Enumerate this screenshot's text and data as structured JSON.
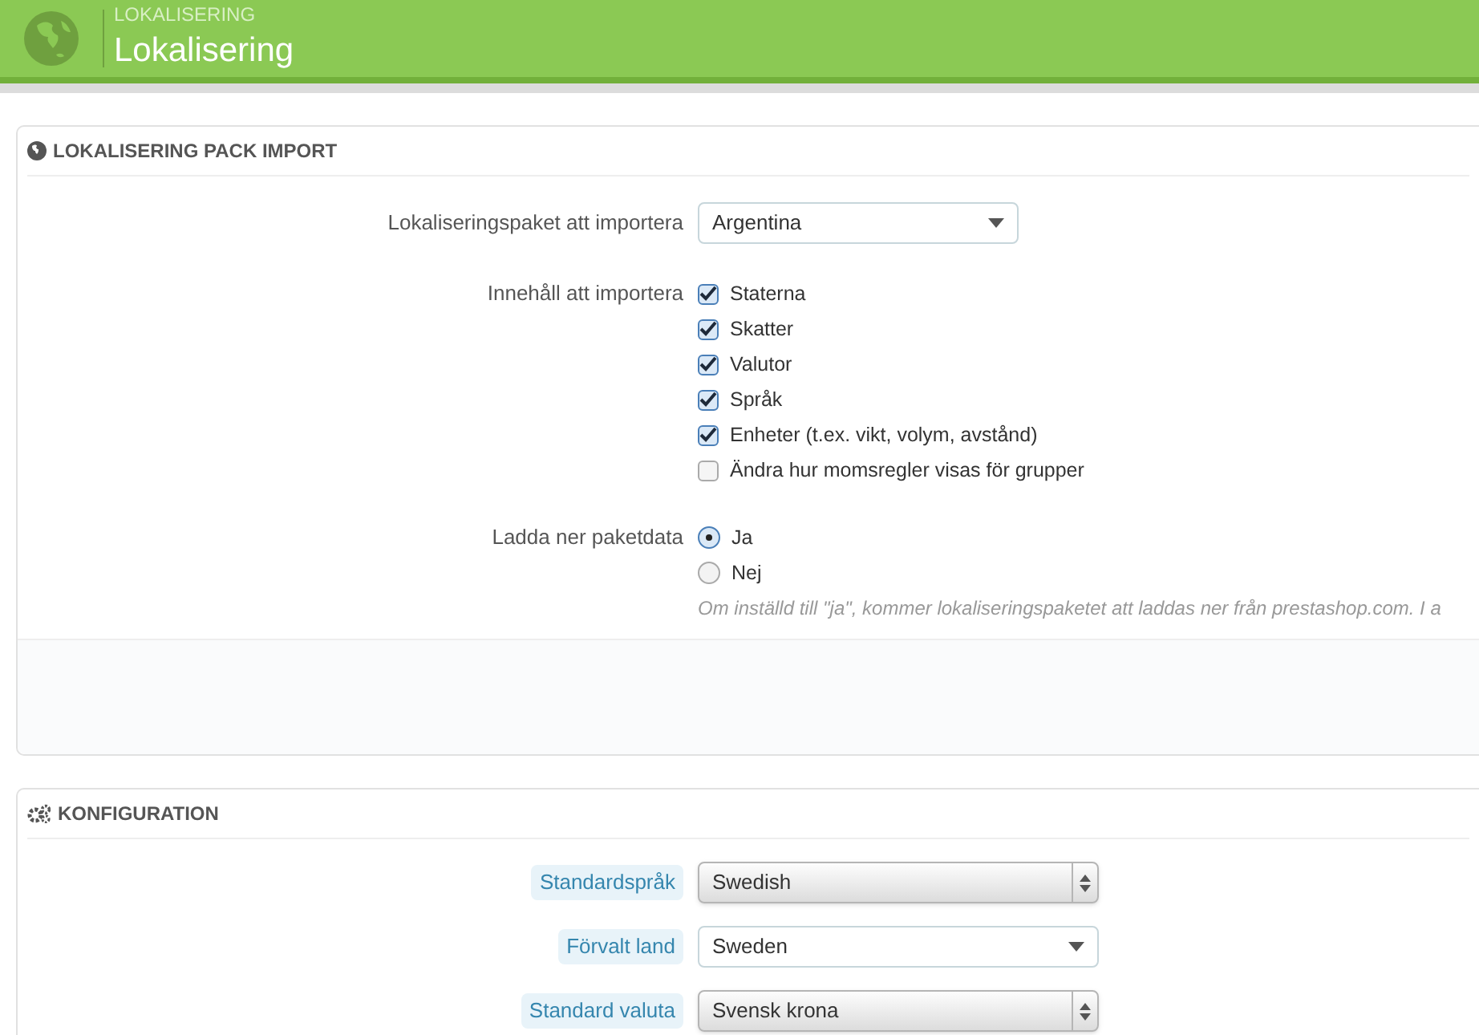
{
  "header": {
    "breadcrumb": "LOKALISERING",
    "title": "Lokalisering"
  },
  "import_panel": {
    "title": "LOKALISERING PACK IMPORT",
    "pack": {
      "label": "Lokaliseringspaket att importera",
      "value": "Argentina"
    },
    "content": {
      "label": "Innehåll att importera",
      "options": [
        {
          "label": "Staterna",
          "checked": true
        },
        {
          "label": "Skatter",
          "checked": true
        },
        {
          "label": "Valutor",
          "checked": true
        },
        {
          "label": "Språk",
          "checked": true
        },
        {
          "label": "Enheter (t.ex. vikt, volym, avstånd)",
          "checked": true
        },
        {
          "label": "Ändra hur momsregler visas för grupper",
          "checked": false
        }
      ]
    },
    "download": {
      "label": "Ladda ner paketdata",
      "options": [
        {
          "label": "Ja",
          "selected": true
        },
        {
          "label": "Nej",
          "selected": false
        }
      ],
      "help": "Om inställd till \"ja\", kommer lokaliseringspaketet att laddas ner från prestashop.com. I a"
    }
  },
  "config_panel": {
    "title": "KONFIGURATION",
    "fields": [
      {
        "label": "Standardspråk",
        "value": "Swedish",
        "kind": "native"
      },
      {
        "label": "Förvalt land",
        "value": "Sweden",
        "kind": "dropdown"
      },
      {
        "label": "Standard valuta",
        "value": "Svensk krona",
        "kind": "native"
      }
    ]
  }
}
